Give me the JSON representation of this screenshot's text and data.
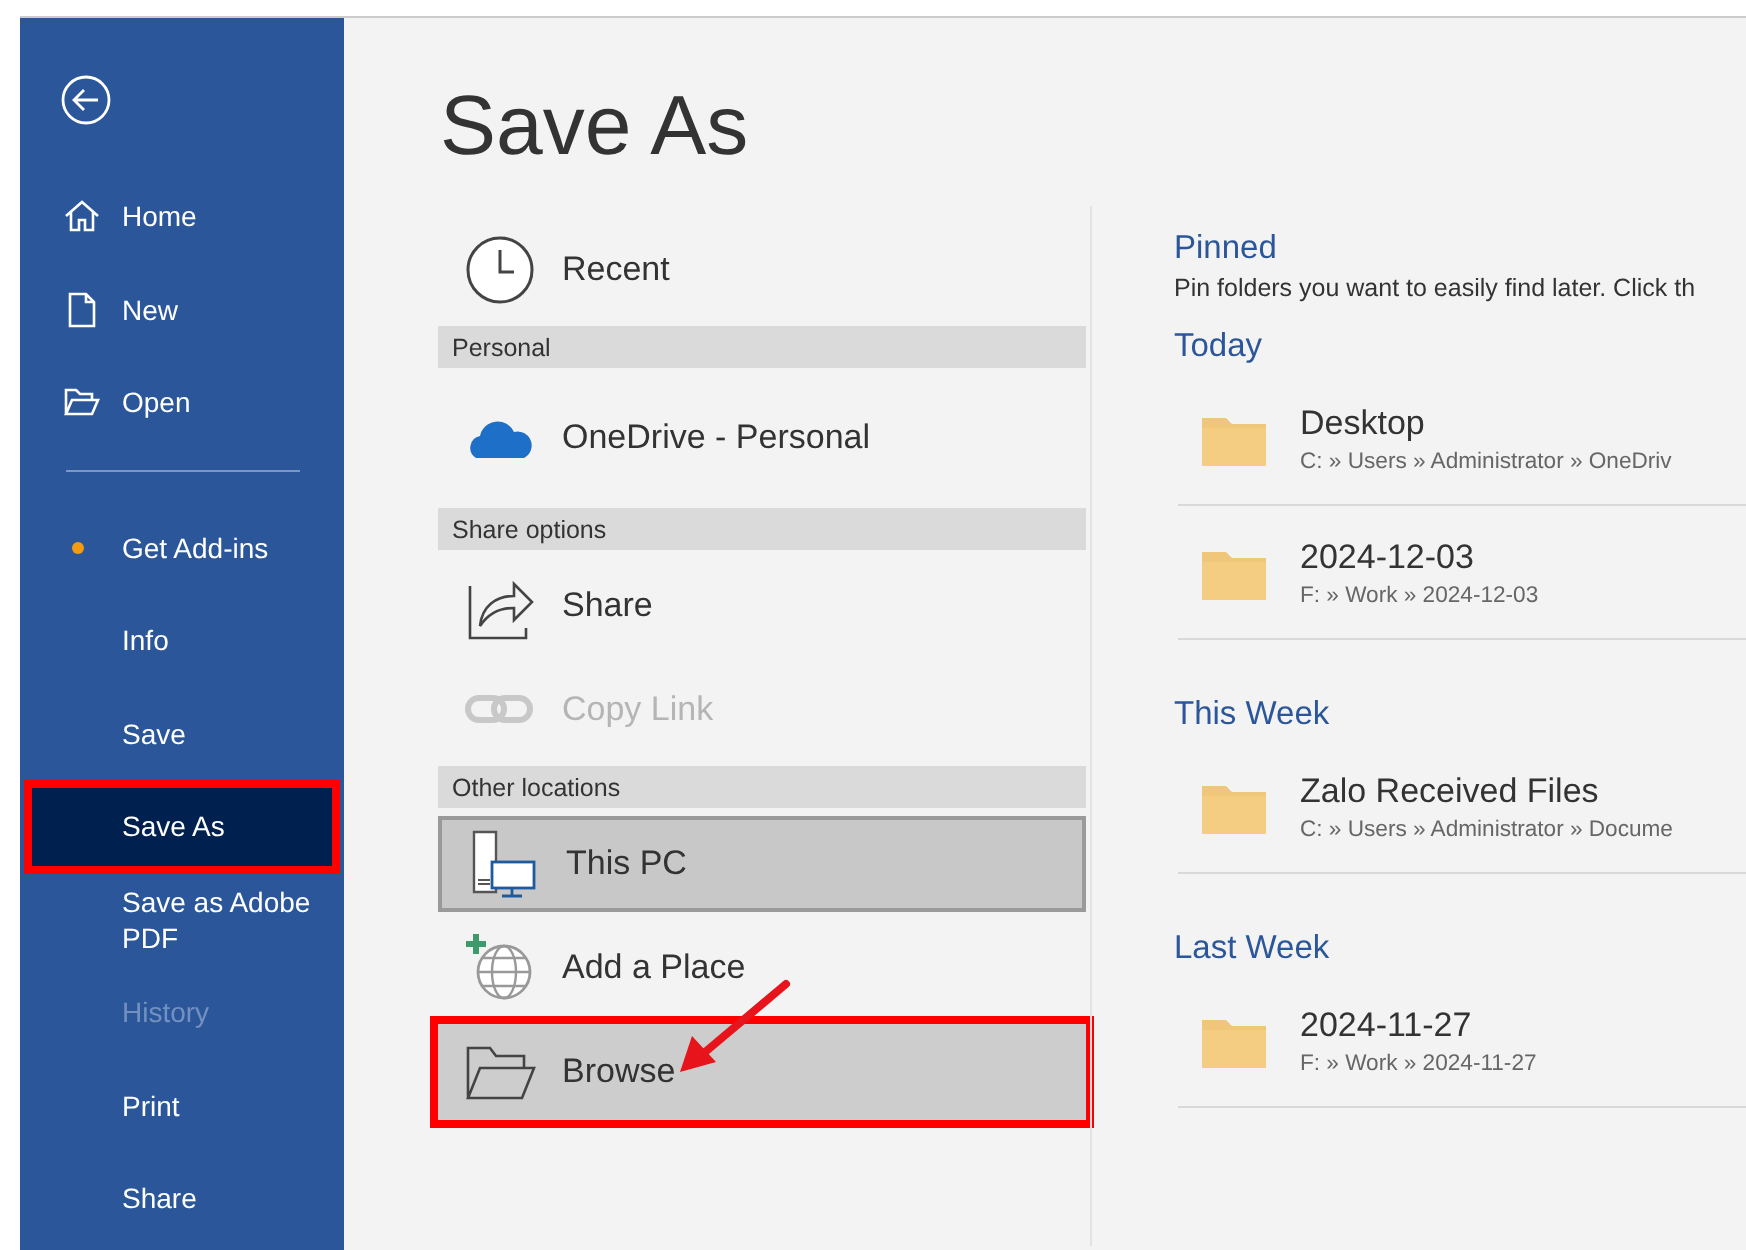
{
  "page_title": "Save As",
  "sidebar": {
    "items": [
      {
        "kind": "home",
        "label": "Home",
        "selected": false,
        "disabled": false,
        "dot": false,
        "annotated": false
      },
      {
        "kind": "new",
        "label": "New",
        "selected": false,
        "disabled": false,
        "dot": false,
        "annotated": false
      },
      {
        "kind": "open",
        "label": "Open",
        "selected": false,
        "disabled": false,
        "dot": false,
        "annotated": false
      },
      {
        "kind": "divider"
      },
      {
        "kind": "plain",
        "label": "Get Add-ins",
        "selected": false,
        "disabled": false,
        "dot": true,
        "annotated": false
      },
      {
        "kind": "plain",
        "label": "Info",
        "selected": false,
        "disabled": false,
        "dot": false,
        "annotated": false
      },
      {
        "kind": "plain",
        "label": "Save",
        "selected": false,
        "disabled": false,
        "dot": false,
        "annotated": false
      },
      {
        "kind": "plain",
        "label": "Save As",
        "selected": true,
        "disabled": false,
        "dot": false,
        "annotated": true
      },
      {
        "kind": "plain",
        "label": "Save as Adobe PDF",
        "selected": false,
        "disabled": false,
        "dot": false,
        "annotated": false
      },
      {
        "kind": "plain",
        "label": "History",
        "selected": false,
        "disabled": true,
        "dot": false,
        "annotated": false
      },
      {
        "kind": "plain",
        "label": "Print",
        "selected": false,
        "disabled": false,
        "dot": false,
        "annotated": false
      },
      {
        "kind": "plain",
        "label": "Share",
        "selected": false,
        "disabled": false,
        "dot": false,
        "annotated": false
      }
    ]
  },
  "locations": [
    {
      "kind": "clock",
      "label": "Recent",
      "selected": false,
      "disabled": false,
      "hovered": false,
      "annotated": false
    },
    {
      "kind": "header",
      "label": "Personal"
    },
    {
      "kind": "cloud",
      "label": "OneDrive - Personal",
      "selected": false,
      "disabled": false,
      "hovered": false,
      "annotated": false
    },
    {
      "kind": "header",
      "label": "Share options"
    },
    {
      "kind": "share",
      "label": "Share",
      "selected": false,
      "disabled": false,
      "hovered": false,
      "annotated": false
    },
    {
      "kind": "link",
      "label": "Copy Link",
      "selected": false,
      "disabled": true,
      "hovered": false,
      "annotated": false
    },
    {
      "kind": "header",
      "label": "Other locations"
    },
    {
      "kind": "computer",
      "label": "This PC",
      "selected": true,
      "disabled": false,
      "hovered": false,
      "annotated": false
    },
    {
      "kind": "globe",
      "label": "Add a Place",
      "selected": false,
      "disabled": false,
      "hovered": false,
      "annotated": false
    },
    {
      "kind": "folder",
      "label": "Browse",
      "selected": false,
      "disabled": false,
      "hovered": true,
      "annotated": true
    }
  ],
  "folders": {
    "pinned_heading": "Pinned",
    "pinned_hint": "Pin folders you want to easily find later. Click th",
    "groups": [
      {
        "heading": "Today",
        "items": [
          {
            "name": "Desktop",
            "path": "C: » Users » Administrator » OneDriv"
          },
          {
            "name": "2024-12-03",
            "path": "F: » Work » 2024-12-03"
          }
        ]
      },
      {
        "heading": "This Week",
        "items": [
          {
            "name": "Zalo Received Files",
            "path": "C: » Users » Administrator » Docume"
          }
        ]
      },
      {
        "heading": "Last Week",
        "items": [
          {
            "name": "2024-11-27",
            "path": "F: » Work » 2024-11-27"
          }
        ]
      }
    ]
  }
}
